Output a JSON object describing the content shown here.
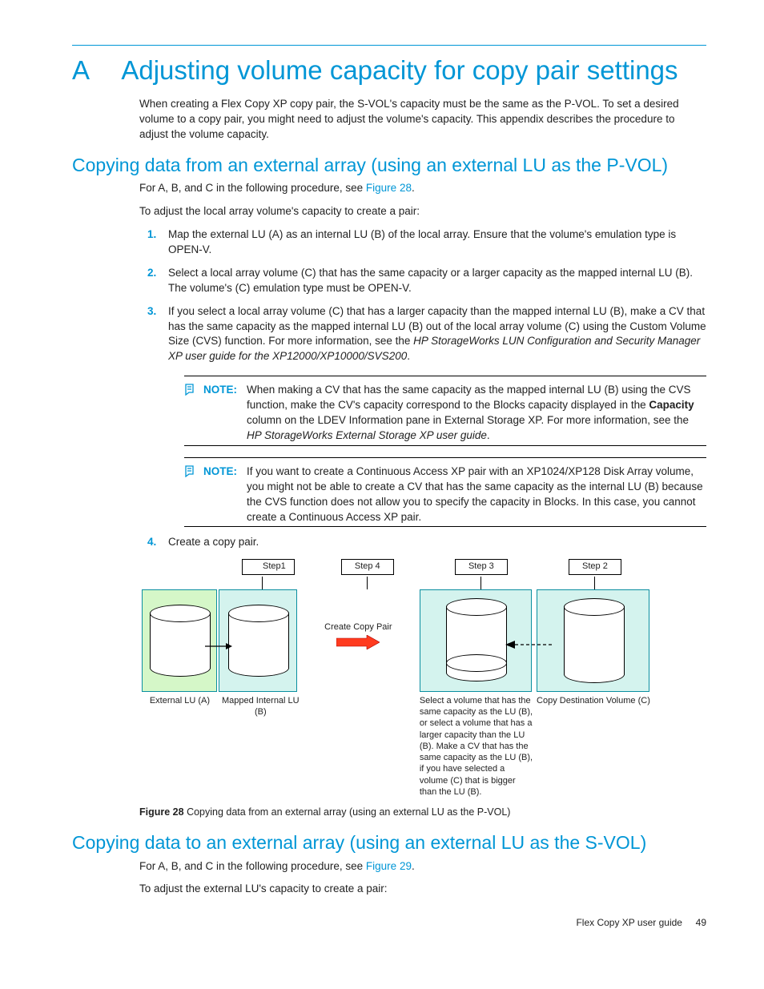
{
  "appendix_letter": "A",
  "appendix_title": "Adjusting volume capacity for copy pair settings",
  "intro": "When creating a Flex Copy XP copy pair, the S-VOL's capacity must be the same as the P-VOL. To set a desired volume to a copy pair, you might need to adjust the volume's capacity. This appendix describes the procedure to adjust the volume capacity.",
  "section1_title": "Copying data from an external array (using an external LU as the P-VOL)",
  "s1_intro_pre": "For A, B, and C in the following procedure, see ",
  "s1_intro_link": "Figure 28",
  "s1_intro_post": ".",
  "s1_intro2": "To adjust the local array volume's capacity to create a pair:",
  "steps": {
    "s1": "Map the external LU (A) as an internal LU (B) of the local array. Ensure that the volume's emulation type is OPEN-V.",
    "s2": "Select a local array volume (C) that has the same capacity or a larger capacity as the mapped internal LU (B). The volume's (C) emulation type must be OPEN-V.",
    "s3a": "If you select a local array volume (C) that has a larger capacity than the mapped internal LU (B), make a CV that has the same capacity as the mapped internal LU (B) out of the local array volume (C) using the Custom Volume Size (CVS) function. For more information, see the ",
    "s3_title": "HP StorageWorks LUN Configuration and Security Manager XP user guide for the XP12000/XP10000/SVS200",
    "s3b": ".",
    "s4": "Create a copy pair."
  },
  "note1": {
    "label": "NOTE:",
    "t1": "When making a CV that has the same capacity as the mapped internal LU (B) using the CVS function, make the CV's capacity correspond to the Blocks capacity displayed in the ",
    "bold": "Capacity",
    "t2": " column on the LDEV Information pane in External Storage XP. For more information, see the ",
    "title": "HP StorageWorks External Storage XP user guide",
    "t3": "."
  },
  "note2": {
    "label": "NOTE:",
    "text": "If you want to create a Continuous Access XP pair with an XP1024/XP128 Disk Array volume, you might not be able to create a CV that has the same capacity as the internal LU (B) because the CVS function does not allow you to specify the capacity in Blocks. In this case, you cannot create a Continuous Access XP pair."
  },
  "figure": {
    "step1": "Step1",
    "step4": "Step 4",
    "step3": "Step 3",
    "step2": "Step 2",
    "create_label": "Create Copy Pair",
    "label_a": "External LU (A)",
    "label_b": "Mapped Internal LU (B)",
    "label_c_long": "Select a volume that has the same capacity as the LU (B), or select a volume that has a larger capacity than the LU (B). Make a CV that has the same capacity as the LU (B), if you have selected a volume (C) that is bigger than the LU (B).",
    "label_c_title": "Copy Destination Volume (C)",
    "caption_label": "Figure 28",
    "caption_text": "Copying data from an external array (using an external LU as the P-VOL)"
  },
  "section2_title": "Copying data to an external array (using an external LU as the S-VOL)",
  "s2_intro_pre": "For A, B, and C in the following procedure, see ",
  "s2_intro_link": "Figure 29",
  "s2_intro_post": ".",
  "s2_intro2": "To adjust the external LU's capacity to create a pair:",
  "footer_text": "Flex Copy XP user guide",
  "footer_page": "49"
}
